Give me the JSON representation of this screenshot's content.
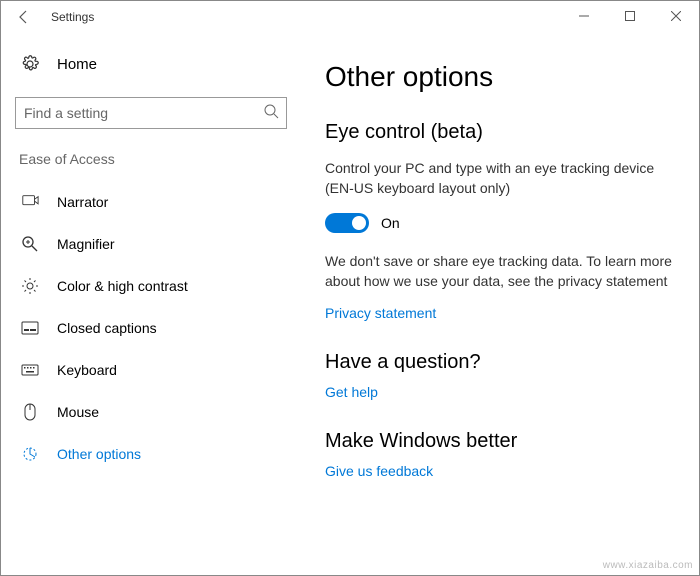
{
  "window": {
    "title": "Settings"
  },
  "sidebar": {
    "home": "Home",
    "search_placeholder": "Find a setting",
    "category": "Ease of Access",
    "items": [
      {
        "label": "Narrator"
      },
      {
        "label": "Magnifier"
      },
      {
        "label": "Color & high contrast"
      },
      {
        "label": "Closed captions"
      },
      {
        "label": "Keyboard"
      },
      {
        "label": "Mouse"
      },
      {
        "label": "Other options"
      }
    ]
  },
  "main": {
    "title": "Other options",
    "section1": {
      "heading": "Eye control (beta)",
      "desc": "Control your PC and type with an eye tracking device (EN-US keyboard layout only)",
      "toggle_state": "On",
      "privacy_text": "We don't save or share eye tracking data. To learn more about how we use your data, see the privacy statement",
      "privacy_link": "Privacy statement"
    },
    "section2": {
      "heading": "Have a question?",
      "link": "Get help"
    },
    "section3": {
      "heading": "Make Windows better",
      "link": "Give us feedback"
    }
  },
  "watermark": "www.xiazaiba.com"
}
